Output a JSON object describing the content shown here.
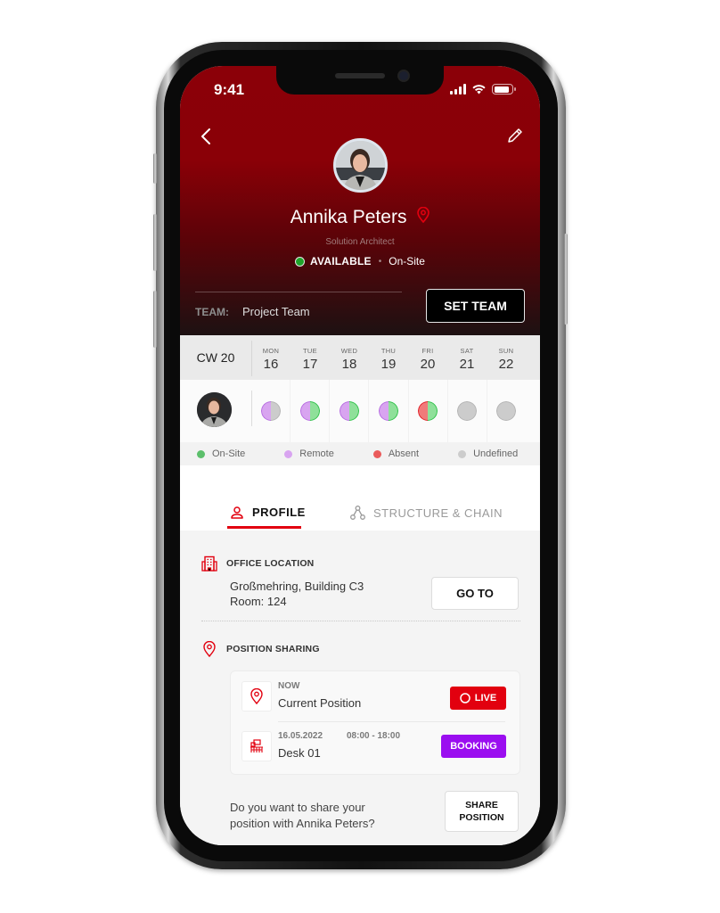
{
  "status_bar": {
    "time": "9:41",
    "battery_level": 0.85
  },
  "profile": {
    "name": "Annika Peters",
    "role": "Solution Architect",
    "availability": "AVAILABLE",
    "location_mode": "On-Site",
    "team_label": "TEAM:",
    "team_value": "Project Team",
    "set_team_label": "SET TEAM"
  },
  "icons": {
    "back": "chevron-left-icon",
    "edit": "pencil-icon",
    "location": "map-pin-icon",
    "profile_tab": "person-icon",
    "structure_tab": "org-chart-icon",
    "office": "building-icon",
    "desk": "desk-icon",
    "live": "record-icon"
  },
  "calendar": {
    "week_label": "CW 20",
    "days": [
      {
        "name": "MON",
        "num": "16",
        "left": "remote",
        "right": "undefined"
      },
      {
        "name": "TUE",
        "num": "17",
        "left": "remote",
        "right": "onsite"
      },
      {
        "name": "WED",
        "num": "18",
        "left": "remote",
        "right": "onsite"
      },
      {
        "name": "THU",
        "num": "19",
        "left": "remote",
        "right": "onsite"
      },
      {
        "name": "FRI",
        "num": "20",
        "left": "absent",
        "right": "onsite"
      },
      {
        "name": "SAT",
        "num": "21",
        "left": "undefined",
        "right": "undefined"
      },
      {
        "name": "SUN",
        "num": "22",
        "left": "undefined",
        "right": "undefined"
      }
    ],
    "legend": [
      {
        "key": "onsite",
        "label": "On-Site"
      },
      {
        "key": "remote",
        "label": "Remote"
      },
      {
        "key": "absent",
        "label": "Absent"
      },
      {
        "key": "undefined",
        "label": "Undefined"
      }
    ]
  },
  "colors": {
    "accent": "#e2000f",
    "onsite": "#8fe09a",
    "onsite_border": "#2cc046",
    "remote": "#d8a4f0",
    "remote_border": "#b56ae0",
    "absent": "#f07a7a",
    "absent_border": "#e01b24",
    "undefined": "#cccccc",
    "undefined_border": "#b3b3b3",
    "live_badge": "#e2000f",
    "booking_badge": "#9b0ef0"
  },
  "tabs": [
    {
      "label": "PROFILE",
      "active": true
    },
    {
      "label": "STRUCTURE & CHAIN",
      "active": false
    }
  ],
  "office": {
    "title": "OFFICE LOCATION",
    "line1": "Großmehring, Building C3",
    "line2": "Room: 124",
    "go_to_label": "GO TO"
  },
  "position_sharing": {
    "title": "POSITION SHARING",
    "items": [
      {
        "small": "NOW",
        "main": "Current Position",
        "badge": "LIVE"
      },
      {
        "small_date": "16.05.2022",
        "small_time": "08:00 - 18:00",
        "main": "Desk 01",
        "badge": "BOOKING"
      }
    ],
    "share_prompt_line1": "Do you want to share your",
    "share_prompt_line2": "position with Annika Peters?",
    "share_button_line1": "SHARE",
    "share_button_line2": "POSITION"
  }
}
